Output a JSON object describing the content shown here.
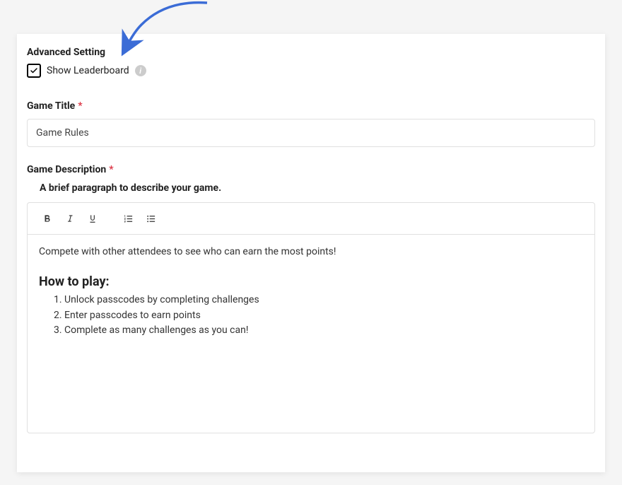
{
  "advanced": {
    "heading": "Advanced Setting",
    "checkbox_label": "Show Leaderboard",
    "checkbox_checked": true
  },
  "title_field": {
    "label": "Game Title",
    "required_mark": "*",
    "value": "Game Rules"
  },
  "description_field": {
    "label": "Game Description",
    "required_mark": "*",
    "helper": "A brief paragraph to describe your game."
  },
  "editor": {
    "intro_paragraph": "Compete with other attendees to see who can earn the most points!",
    "heading": "How to play:",
    "steps": [
      "Unlock passcodes by completing challenges",
      "Enter passcodes to earn points",
      "Complete as many challenges as you can!"
    ]
  },
  "arrow_color": "#3b6cd6"
}
